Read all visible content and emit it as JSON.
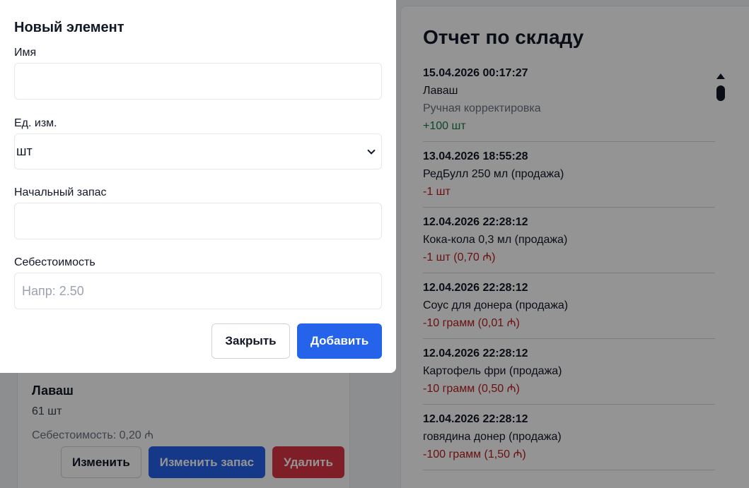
{
  "item_card": {
    "name": "Лаваш",
    "quantity": "61 шт",
    "cost": "Себестоимость: 0,20 ₼",
    "edit_label": "Изменить",
    "edit_stock_label": "Изменить запас",
    "delete_label": "Удалить"
  },
  "report": {
    "title": "Отчет по складу",
    "entries": [
      {
        "date": "15.04.2026 00:17:27",
        "name": "Лаваш",
        "note": "Ручная корректировка",
        "delta": "+100 шт",
        "positive": true
      },
      {
        "date": "13.04.2026 18:55:28",
        "name": "РедБулл 250 мл (продажа)",
        "note": "",
        "delta": "-1 шт",
        "positive": false
      },
      {
        "date": "12.04.2026 22:28:12",
        "name": "Кока-кола 0,3 мл (продажа)",
        "note": "",
        "delta": "-1 шт (0,70 ₼)",
        "positive": false
      },
      {
        "date": "12.04.2026 22:28:12",
        "name": "Соус для донера (продажа)",
        "note": "",
        "delta": "-10 грамм (0,01 ₼)",
        "positive": false
      },
      {
        "date": "12.04.2026 22:28:12",
        "name": "Картофель фри (продажа)",
        "note": "",
        "delta": "-10 грамм (0,50 ₼)",
        "positive": false
      },
      {
        "date": "12.04.2026 22:28:12",
        "name": "говядина донер (продажа)",
        "note": "",
        "delta": "-100 грамм (1,50 ₼)",
        "positive": false
      }
    ]
  },
  "modal": {
    "title": "Новый элемент",
    "name_label": "Имя",
    "name_value": "",
    "unit_label": "Ед. изм.",
    "unit_value": "шт",
    "initial_stock_label": "Начальный запас",
    "initial_stock_value": "",
    "cost_label": "Себестоимость",
    "cost_placeholder": "Напр: 2.50",
    "close_label": "Закрыть",
    "add_label": "Добавить"
  },
  "colors": {
    "primary": "#2563eb",
    "danger": "#dc3545",
    "positive": "#15803d",
    "negative": "#b91c1c"
  }
}
